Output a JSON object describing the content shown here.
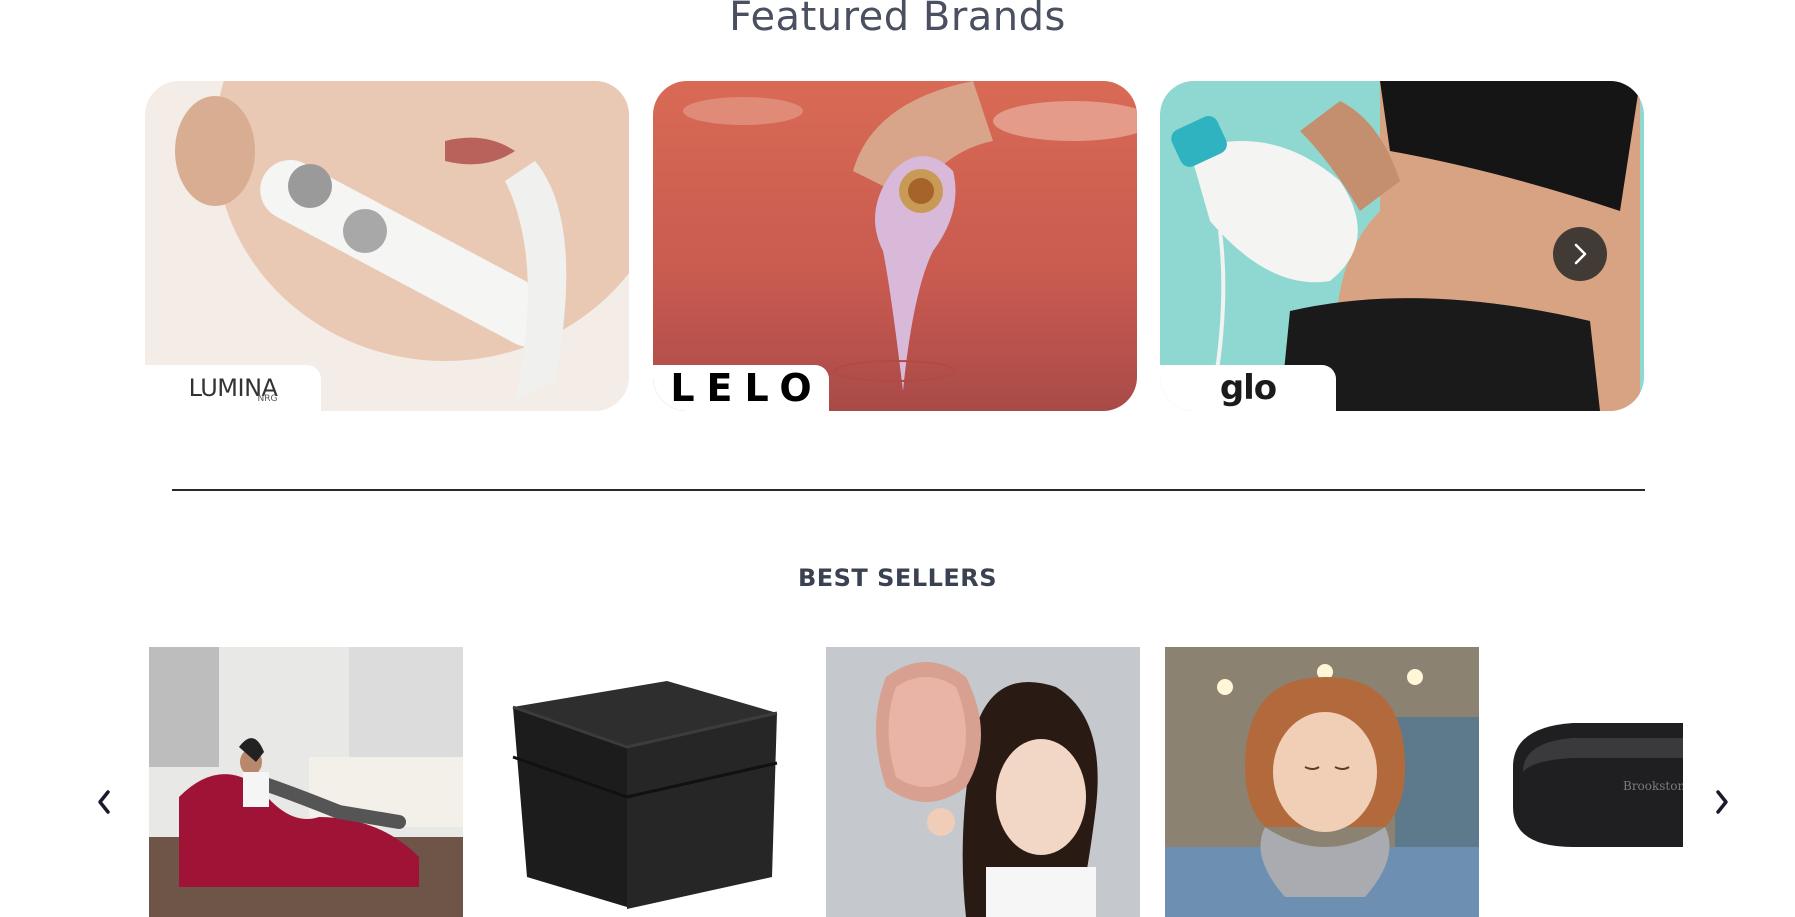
{
  "featured": {
    "title": "Featured Brands",
    "brands": [
      {
        "logo_text": "LUMINA",
        "logo_subtext": "NRG"
      },
      {
        "logo_text": "LELO"
      },
      {
        "logo_text": "glo"
      }
    ],
    "next_icon": "chevron-right-icon"
  },
  "best_sellers": {
    "title": "BEST SELLERS",
    "prev_icon": "chevron-left-icon",
    "next_icon": "chevron-right-icon",
    "partial_product_text": "Brookstone"
  },
  "colors": {
    "text": "#3a4150",
    "divider": "#2a2a2a",
    "arrow_bg": "#282828"
  }
}
